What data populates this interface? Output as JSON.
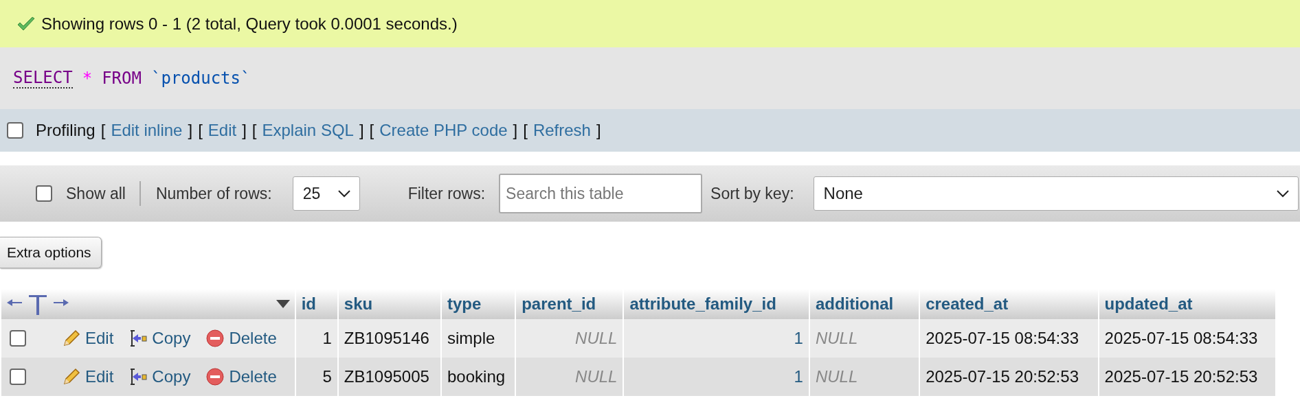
{
  "success_message": "Showing rows 0 - 1 (2 total, Query took 0.0001 seconds.)",
  "sql": [
    {
      "kind": "keyword",
      "text": "SELECT"
    },
    {
      "kind": "operator",
      "text": "*"
    },
    {
      "kind": "keyword",
      "text": "FROM"
    },
    {
      "kind": "identifier",
      "text": "`products`"
    }
  ],
  "profiling": {
    "label": "Profiling",
    "checked": false,
    "items": [
      {
        "kind": "bracket",
        "text": "["
      },
      {
        "kind": "link",
        "text": "Edit inline"
      },
      {
        "kind": "bracket",
        "text": "]"
      },
      {
        "kind": "bracket",
        "text": "["
      },
      {
        "kind": "link",
        "text": "Edit"
      },
      {
        "kind": "bracket",
        "text": "]"
      },
      {
        "kind": "bracket",
        "text": "["
      },
      {
        "kind": "link",
        "text": "Explain SQL"
      },
      {
        "kind": "bracket",
        "text": "]"
      },
      {
        "kind": "bracket",
        "text": "["
      },
      {
        "kind": "link",
        "text": "Create PHP code"
      },
      {
        "kind": "bracket",
        "text": "]"
      },
      {
        "kind": "bracket",
        "text": "["
      },
      {
        "kind": "link",
        "text": "Refresh"
      },
      {
        "kind": "bracket",
        "text": "]"
      }
    ]
  },
  "toolbar": {
    "show_all": {
      "label": "Show all",
      "checked": false
    },
    "rows_label": "Number of rows:",
    "rows_value": "25",
    "filter_label": "Filter rows:",
    "filter_placeholder": "Search this table",
    "sort_label": "Sort by key:",
    "sort_value": "None"
  },
  "extra_options": "Extra options",
  "table": {
    "columns": [
      {
        "name": "id",
        "kind": "numeric"
      },
      {
        "name": "sku",
        "kind": "string"
      },
      {
        "name": "type",
        "kind": "string"
      },
      {
        "name": "parent_id",
        "kind": "numeric"
      },
      {
        "name": "attribute_family_id",
        "kind": "numeric"
      },
      {
        "name": "additional",
        "kind": "string"
      },
      {
        "name": "created_at",
        "kind": "string"
      },
      {
        "name": "updated_at",
        "kind": "string"
      }
    ],
    "rows": [
      {
        "checked": false,
        "actions": [
          {
            "kind": "edit",
            "label": "Edit"
          },
          {
            "kind": "copy",
            "label": "Copy"
          },
          {
            "kind": "delete",
            "label": "Delete"
          }
        ],
        "cells": [
          {
            "kind": "text",
            "text": "1"
          },
          {
            "kind": "text",
            "text": "ZB1095146"
          },
          {
            "kind": "text",
            "text": "simple"
          },
          {
            "kind": "null",
            "text": "NULL"
          },
          {
            "kind": "link",
            "text": "1"
          },
          {
            "kind": "null",
            "text": "NULL"
          },
          {
            "kind": "text",
            "text": "2025-07-15 08:54:33"
          },
          {
            "kind": "text",
            "text": "2025-07-15 08:54:33"
          }
        ]
      },
      {
        "checked": false,
        "actions": [
          {
            "kind": "edit",
            "label": "Edit"
          },
          {
            "kind": "copy",
            "label": "Copy"
          },
          {
            "kind": "delete",
            "label": "Delete"
          }
        ],
        "cells": [
          {
            "kind": "text",
            "text": "5"
          },
          {
            "kind": "text",
            "text": "ZB1095005"
          },
          {
            "kind": "text",
            "text": "booking"
          },
          {
            "kind": "null",
            "text": "NULL"
          },
          {
            "kind": "link",
            "text": "1"
          },
          {
            "kind": "null",
            "text": "NULL"
          },
          {
            "kind": "text",
            "text": "2025-07-15 20:52:53"
          },
          {
            "kind": "text",
            "text": "2025-07-15 20:52:53"
          }
        ]
      }
    ]
  }
}
